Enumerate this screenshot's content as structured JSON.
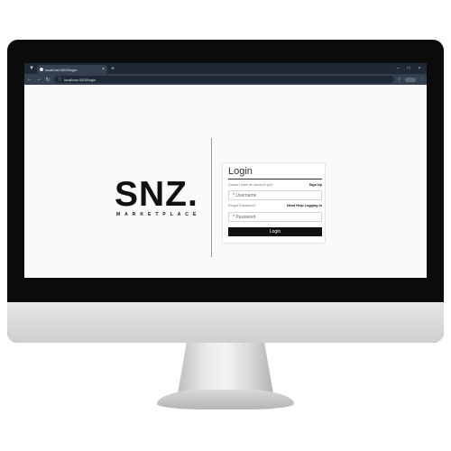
{
  "browser": {
    "tab_title": "localhost:3000/login",
    "new_tab_symbol": "+",
    "url": "localhost:3000/login",
    "nav": {
      "back_icon": "back-arrow-icon",
      "forward_icon": "forward-arrow-icon",
      "reload_icon": "reload-icon"
    }
  },
  "brand": {
    "name": "SNZ.",
    "tagline": "MARKETPLACE"
  },
  "login": {
    "title": "Login",
    "no_account_text": "Doesn't have an account yet?",
    "sign_up_link": "Sign Up",
    "username_placeholder": "* Username",
    "forgot_password_text": "Forgot Password?",
    "need_help_link": "Need Help Logging In",
    "password_placeholder": "* Password",
    "login_button": "Login"
  },
  "colors": {
    "browser_chrome": "#1f2936",
    "page_background": "#fafafa",
    "button_background": "#111111"
  }
}
